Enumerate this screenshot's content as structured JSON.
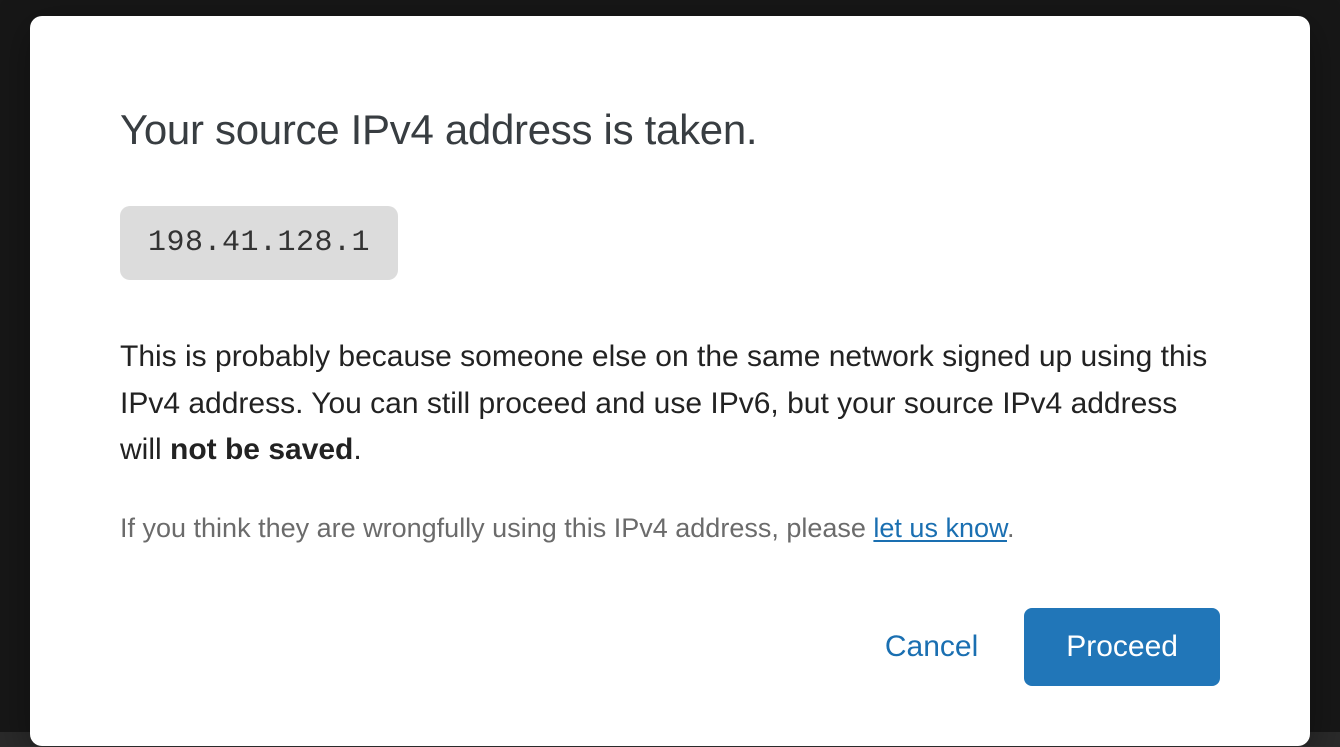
{
  "dialog": {
    "title": "Your source IPv4 address is taken.",
    "ip_address": "198.41.128.1",
    "body_prefix": "This is probably because someone else on the same network signed up using this IPv4 address. You can still proceed and use IPv6, but your source IPv4 address will ",
    "body_bold": "not be saved",
    "body_suffix": ".",
    "hint_prefix": "If you think they are wrongfully using this IPv4 address, please ",
    "hint_link": "let us know",
    "hint_suffix": ".",
    "cancel_label": "Cancel",
    "proceed_label": "Proceed"
  }
}
